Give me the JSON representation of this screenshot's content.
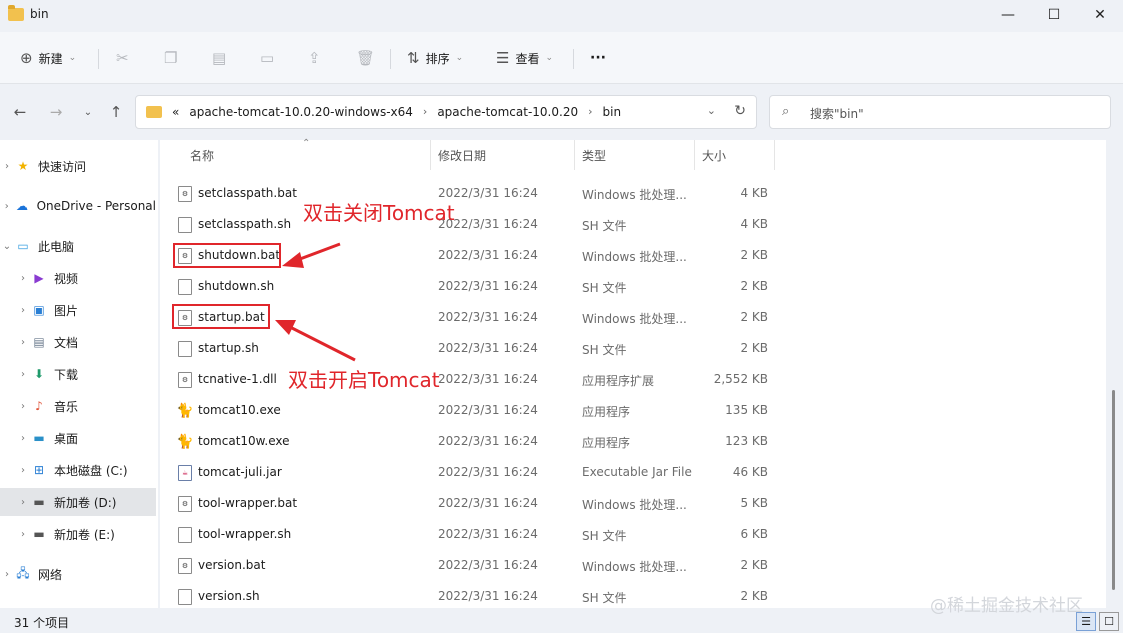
{
  "window": {
    "title": "bin",
    "controls": {
      "minimize": "—",
      "maximize": "☐",
      "close": "✕"
    }
  },
  "toolbar": {
    "new_label": "新建",
    "sort_label": "排序",
    "view_label": "查看",
    "more_label": "···",
    "icons": [
      "cut-icon",
      "copy-icon",
      "paste-icon",
      "rename-icon",
      "share-icon",
      "delete-icon"
    ]
  },
  "address": {
    "crumbs": [
      "apache-tomcat-10.0.20-windows-x64",
      "apache-tomcat-10.0.20",
      "bin"
    ],
    "overflow": "«",
    "search_placeholder": "搜索\"bin\""
  },
  "sidebar": {
    "items": [
      {
        "label": "快速访问",
        "icon": "star-icon",
        "expand": "›"
      },
      {
        "label": "OneDrive - Personal",
        "icon": "cloud-icon",
        "expand": "›"
      },
      {
        "label": "此电脑",
        "icon": "computer-icon",
        "expand": "⌄"
      },
      {
        "label": "视频",
        "icon": "video-icon",
        "expand": "›"
      },
      {
        "label": "图片",
        "icon": "picture-icon",
        "expand": "›"
      },
      {
        "label": "文档",
        "icon": "document-icon",
        "expand": "›"
      },
      {
        "label": "下载",
        "icon": "download-icon",
        "expand": "›"
      },
      {
        "label": "音乐",
        "icon": "music-icon",
        "expand": "›"
      },
      {
        "label": "桌面",
        "icon": "desktop-icon",
        "expand": "›"
      },
      {
        "label": "本地磁盘 (C:)",
        "icon": "windows-drive-icon",
        "expand": "›"
      },
      {
        "label": "新加卷 (D:)",
        "icon": "drive-icon",
        "expand": "›",
        "selected": true
      },
      {
        "label": "新加卷 (E:)",
        "icon": "drive-icon",
        "expand": "›"
      },
      {
        "label": "网络",
        "icon": "network-icon",
        "expand": "›"
      }
    ]
  },
  "columns": {
    "name": "名称",
    "date": "修改日期",
    "type": "类型",
    "size": "大小"
  },
  "files": [
    {
      "name": "setclasspath.bat",
      "date": "2022/3/31 16:24",
      "type": "Windows 批处理...",
      "size": "4 KB",
      "icon": "bat-file-icon"
    },
    {
      "name": "setclasspath.sh",
      "date": "2022/3/31 16:24",
      "type": "SH 文件",
      "size": "4 KB",
      "icon": "file-icon"
    },
    {
      "name": "shutdown.bat",
      "date": "2022/3/31 16:24",
      "type": "Windows 批处理...",
      "size": "2 KB",
      "icon": "bat-file-icon"
    },
    {
      "name": "shutdown.sh",
      "date": "2022/3/31 16:24",
      "type": "SH 文件",
      "size": "2 KB",
      "icon": "file-icon"
    },
    {
      "name": "startup.bat",
      "date": "2022/3/31 16:24",
      "type": "Windows 批处理...",
      "size": "2 KB",
      "icon": "bat-file-icon"
    },
    {
      "name": "startup.sh",
      "date": "2022/3/31 16:24",
      "type": "SH 文件",
      "size": "2 KB",
      "icon": "file-icon"
    },
    {
      "name": "tcnative-1.dll",
      "date": "2022/3/31 16:24",
      "type": "应用程序扩展",
      "size": "2,552 KB",
      "icon": "dll-file-icon"
    },
    {
      "name": "tomcat10.exe",
      "date": "2022/3/31 16:24",
      "type": "应用程序",
      "size": "135 KB",
      "icon": "tomcat-exe-icon"
    },
    {
      "name": "tomcat10w.exe",
      "date": "2022/3/31 16:24",
      "type": "应用程序",
      "size": "123 KB",
      "icon": "tomcat-exe-icon"
    },
    {
      "name": "tomcat-juli.jar",
      "date": "2022/3/31 16:24",
      "type": "Executable Jar File",
      "size": "46 KB",
      "icon": "jar-file-icon"
    },
    {
      "name": "tool-wrapper.bat",
      "date": "2022/3/31 16:24",
      "type": "Windows 批处理...",
      "size": "5 KB",
      "icon": "bat-file-icon"
    },
    {
      "name": "tool-wrapper.sh",
      "date": "2022/3/31 16:24",
      "type": "SH 文件",
      "size": "6 KB",
      "icon": "file-icon"
    },
    {
      "name": "version.bat",
      "date": "2022/3/31 16:24",
      "type": "Windows 批处理...",
      "size": "2 KB",
      "icon": "bat-file-icon"
    },
    {
      "name": "version.sh",
      "date": "2022/3/31 16:24",
      "type": "SH 文件",
      "size": "2 KB",
      "icon": "file-icon"
    }
  ],
  "annotations": {
    "shutdown": "双击关闭Tomcat",
    "startup": "双击开启Tomcat",
    "color": "#e0262b"
  },
  "status": {
    "count": "31 个项目"
  },
  "watermark": "@稀土掘金技术社区"
}
